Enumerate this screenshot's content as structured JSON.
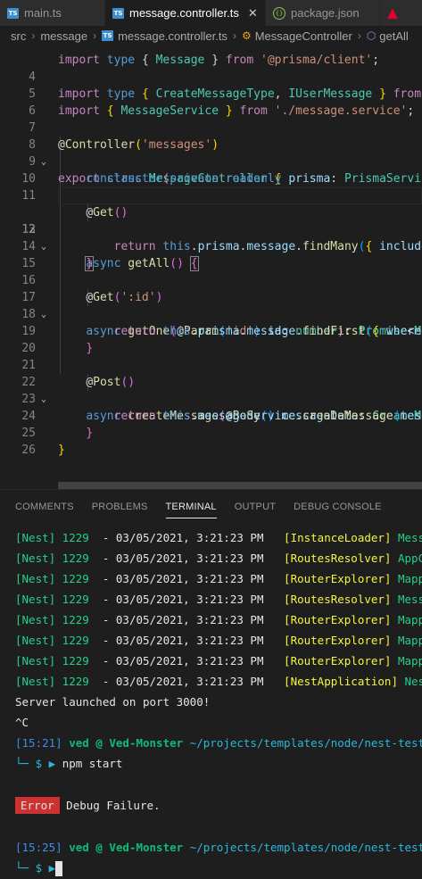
{
  "tabs": [
    {
      "label": "main.ts",
      "icon": "ts-icon",
      "active": false
    },
    {
      "label": "message.controller.ts",
      "icon": "ts-icon",
      "active": true,
      "close": "✕"
    },
    {
      "label": "package.json",
      "icon": "json-icon",
      "active": false
    },
    {
      "label": "",
      "icon": "angular-icon",
      "active": false
    }
  ],
  "breadcrumb": [
    "src",
    "message",
    "message.controller.ts",
    "MessageController",
    "getAll"
  ],
  "editor": {
    "line_numbers": [
      "4",
      "5",
      "6",
      "7",
      "8",
      "9",
      "10",
      "11",
      "12",
      "13",
      "14",
      "15",
      "16",
      "17",
      "18",
      "19",
      "20",
      "21",
      "22",
      "23",
      "24",
      "25",
      "26"
    ],
    "current_line": "12"
  },
  "panel": {
    "tabs": [
      "COMMENTS",
      "PROBLEMS",
      "TERMINAL",
      "OUTPUT",
      "DEBUG CONSOLE"
    ],
    "active_tab": "TERMINAL"
  },
  "terminal": {
    "nest_logs": [
      {
        "prefix": "[Nest] 1229",
        "ts": "  - 03/05/2021, 3:21:23 PM",
        "ctx": "[InstanceLoader]",
        "msg": "Message"
      },
      {
        "prefix": "[Nest] 1229",
        "ts": "  - 03/05/2021, 3:21:23 PM",
        "ctx": "[RoutesResolver]",
        "msg": "AppCont"
      },
      {
        "prefix": "[Nest] 1229",
        "ts": "  - 03/05/2021, 3:21:23 PM",
        "ctx": "[RouterExplorer]",
        "msg": "Mapped"
      },
      {
        "prefix": "[Nest] 1229",
        "ts": "  - 03/05/2021, 3:21:23 PM",
        "ctx": "[RoutesResolver]",
        "msg": "Message"
      },
      {
        "prefix": "[Nest] 1229",
        "ts": "  - 03/05/2021, 3:21:23 PM",
        "ctx": "[RouterExplorer]",
        "msg": "Mapped"
      },
      {
        "prefix": "[Nest] 1229",
        "ts": "  - 03/05/2021, 3:21:23 PM",
        "ctx": "[RouterExplorer]",
        "msg": "Mapped"
      },
      {
        "prefix": "[Nest] 1229",
        "ts": "  - 03/05/2021, 3:21:23 PM",
        "ctx": "[RouterExplorer]",
        "msg": "Mapped"
      },
      {
        "prefix": "[Nest] 1229",
        "ts": "  - 03/05/2021, 3:21:23 PM",
        "ctx": "[NestApplication]",
        "msg": "Nest a"
      }
    ],
    "launched": "Server launched on port 3000!",
    "ctrl_c": "^C",
    "prompt1": {
      "time": "[15:21]",
      "user": "ved @ Ved-Monster",
      "path": "~/projects/templates/node/nest-testing",
      "cmd": "npm start"
    },
    "error_badge": "Error",
    "error_msg": "Debug Failure.",
    "prompt2": {
      "time": "[15:25]",
      "user": "ved @ Ved-Monster",
      "path": "~/projects/templates/node/nest-testing",
      "cmd": ""
    },
    "prompt_glyph": "└─ $ ▶"
  }
}
